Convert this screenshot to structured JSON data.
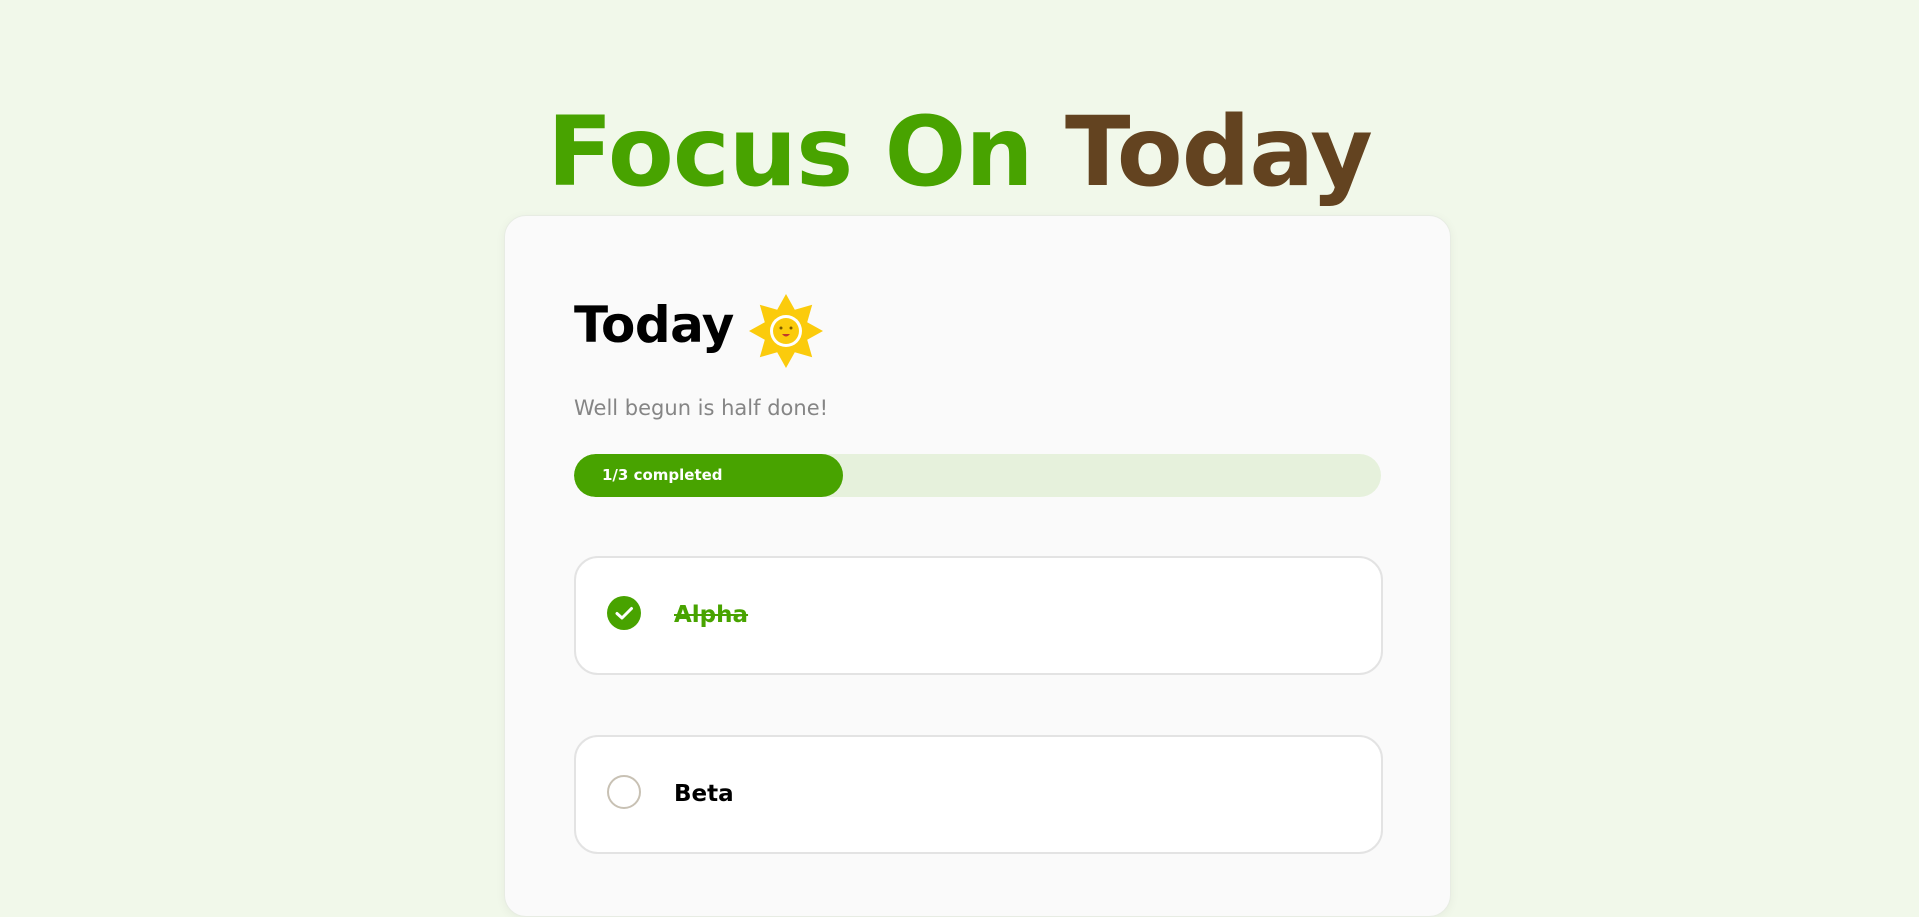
{
  "header": {
    "title_part1": "Focus On",
    "title_part2": "Today"
  },
  "card": {
    "heading": "Today",
    "heading_icon": "sun-icon",
    "quote": "Well begun is half done!",
    "progress": {
      "label": "1/3 completed",
      "completed": 1,
      "total": 3
    },
    "tasks": [
      {
        "text": "Alpha",
        "completed": true,
        "icon": "checkmark-icon"
      },
      {
        "text": "Beta",
        "completed": false,
        "icon": "empty-circle-icon"
      }
    ]
  },
  "colors": {
    "accent_green": "#48a300",
    "accent_brown": "#634320",
    "background": "#f1f8ea",
    "progress_track": "#e6f1dc"
  }
}
